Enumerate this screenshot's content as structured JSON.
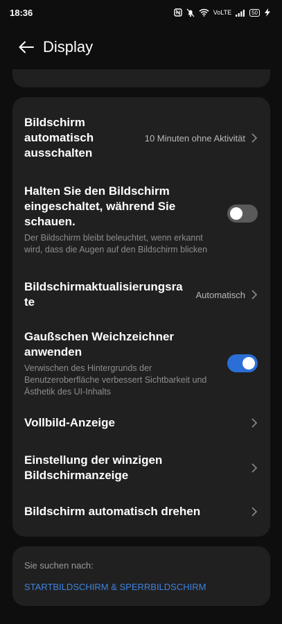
{
  "status_bar": {
    "time": "18:36",
    "volte": "VoLTE",
    "battery": "50"
  },
  "header": {
    "title": "Display"
  },
  "settings": {
    "screen_off": {
      "title": "Bildschirm automatisch ausschalten",
      "value": "10 Minuten ohne Aktivität"
    },
    "keep_on": {
      "title": "Halten Sie den Bildschirm eingeschaltet, während Sie schauen.",
      "subtitle": "Der Bildschirm bleibt beleuchtet, wenn erkannt wird, dass die Augen auf den Bildschirm blicken",
      "enabled": false
    },
    "refresh_rate": {
      "title": "Bildschirmaktualisierungsrate",
      "value": "Automatisch"
    },
    "blur": {
      "title": "Gaußschen Weichzeichner anwenden",
      "subtitle": "Verwischen des Hintergrunds der Benutzeroberfläche verbessert Sichtbarkeit und Ästhetik des UI-Inhalts",
      "enabled": true
    },
    "fullscreen": {
      "title": "Vollbild-Anzeige"
    },
    "tiny_screen": {
      "title": "Einstellung der winzigen Bildschirmanzeige"
    },
    "auto_rotate": {
      "title": "Bildschirm automatisch drehen"
    }
  },
  "search": {
    "label": "Sie suchen nach:",
    "link": "STARTBILDSCHIRM & SPERRBILDSCHIRM"
  },
  "colors": {
    "accent": "#2b6fd6",
    "link": "#3f82e0",
    "card": "#202020",
    "background": "#0e0e0e"
  }
}
